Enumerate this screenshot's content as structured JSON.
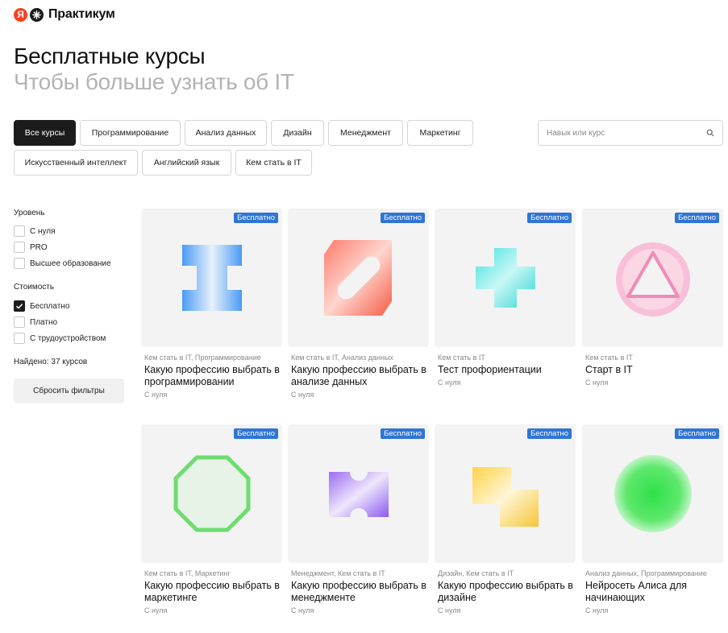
{
  "logo": {
    "ya": "Я",
    "name": "Практикум"
  },
  "header": {
    "title": "Бесплатные курсы",
    "subtitle": "Чтобы больше узнать об IT"
  },
  "chips": [
    "Все курсы",
    "Программирование",
    "Анализ данных",
    "Дизайн",
    "Менеджмент",
    "Маркетинг",
    "Искусственный интеллект",
    "Английский язык",
    "Кем стать в IT"
  ],
  "search": {
    "placeholder": "Навык или курс"
  },
  "filters": {
    "level_heading": "Уровень",
    "levels": [
      "С нуля",
      "PRO",
      "Высшее образование"
    ],
    "cost_heading": "Стоимость",
    "costs": [
      "Бесплатно",
      "Платно",
      "С трудоустройством"
    ],
    "found": "Найдено: 37 курсов",
    "reset_label": "Сбросить фильтры"
  },
  "cards": [
    {
      "badge": "Бесплатно",
      "category": "Кем стать в IT, Программирование",
      "title": "Какую профессию выбрать в программировании",
      "level": "С нуля",
      "shape": "i-beam-blue"
    },
    {
      "badge": "Бесплатно",
      "category": "Кем стать в IT, Анализ данных",
      "title": "Какую профессию выбрать в анализе данных",
      "level": "С нуля",
      "shape": "pill-square-red"
    },
    {
      "badge": "Бесплатно",
      "category": "Кем стать в IT",
      "title": "Тест профориентации",
      "level": "С нуля",
      "shape": "plus-cyan"
    },
    {
      "badge": "Бесплатно",
      "category": "Кем стать в IT",
      "title": "Старт в IT",
      "level": "С нуля",
      "shape": "triangle-ring-pink"
    },
    {
      "badge": "Бесплатно",
      "category": "Кем стать в IT, Маркетинг",
      "title": "Какую профессию выбрать в маркетинге",
      "level": "С нуля",
      "shape": "octagon-green"
    },
    {
      "badge": "Бесплатно",
      "category": "Менеджмент, Кем стать в IT",
      "title": "Какую профессию выбрать в менеджменте",
      "level": "С нуля",
      "shape": "notched-purple"
    },
    {
      "badge": "Бесплатно",
      "category": "Дизайн, Кем стать в IT",
      "title": "Какую профессию выбрать в дизайне",
      "level": "С нуля",
      "shape": "step-yellow"
    },
    {
      "badge": "Бесплатно",
      "category": "Анализ данных, Программирование",
      "title": "Нейросеть Алиса для начинающих",
      "level": "С нуля",
      "shape": "circle-green"
    }
  ],
  "colors": {
    "accent_badge": "#2f75d4",
    "active_chip": "#1c1c1c",
    "brand_red": "#fc3f1d"
  }
}
